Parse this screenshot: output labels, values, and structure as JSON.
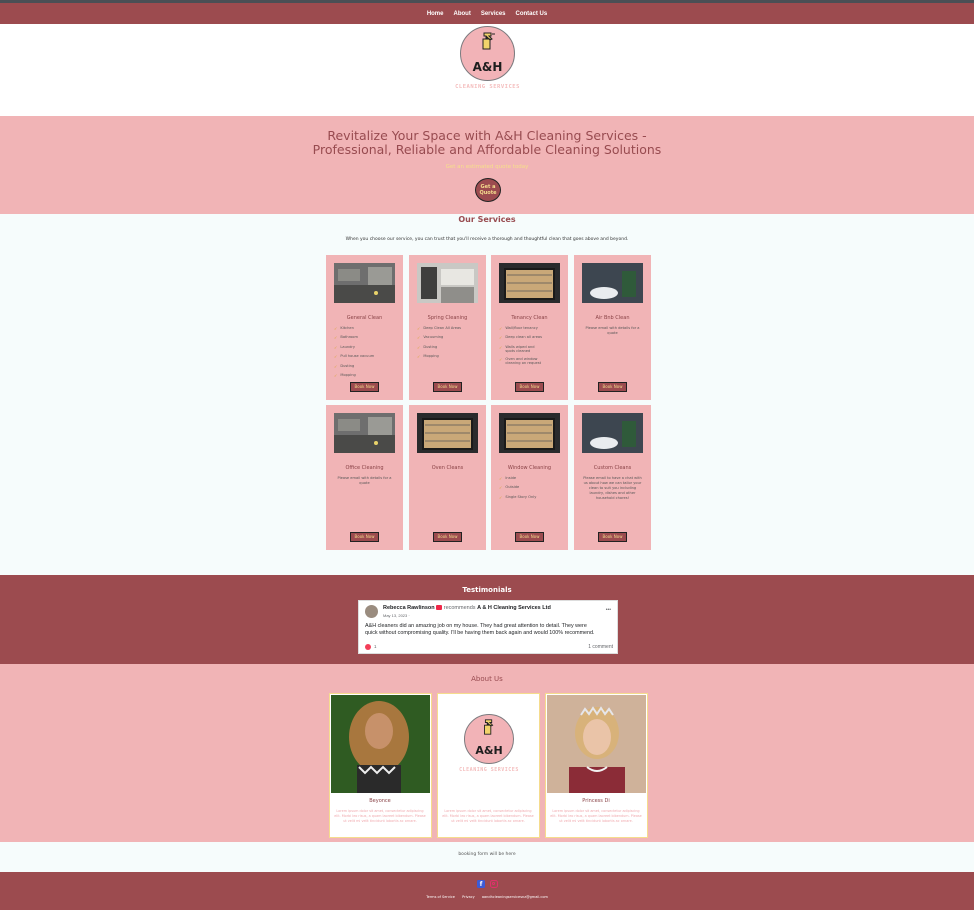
{
  "nav": {
    "items": [
      "Home",
      "About",
      "Services",
      "Contact Us"
    ]
  },
  "logo": {
    "initials": "A&H",
    "subtitle": "CLEANING SERVICES"
  },
  "hero": {
    "title_line1": "Revitalize Your Space with A&H Cleaning Services -",
    "title_line2": "Professional, Reliable and Affordable Cleaning Solutions",
    "quote_text": "Get an estimated quote today",
    "quote_button_line1": "Get a",
    "quote_button_line2": "Quote"
  },
  "services": {
    "title": "Our Services",
    "intro": "When you choose our service, you can trust that you'll receive a thorough and thoughtful clean that goes above and beyond.",
    "book_label": "Book Now",
    "cards": [
      {
        "title": "General Clean",
        "items": [
          "Kitchen",
          "Bathroom",
          "Laundry",
          "Pull house vacuum",
          "Dusting",
          "Mopping"
        ]
      },
      {
        "title": "Spring Cleaning",
        "items": [
          "Deep Clean All Areas",
          "Vacuuming",
          "Dusting",
          "Mopping"
        ]
      },
      {
        "title": "Tenancy Clean",
        "items": [
          "Wall/floor tenancy",
          "Deep clean all areas",
          "Walls wiped and spots cleaned",
          "Oven and window cleaning on request"
        ]
      },
      {
        "title": "Air Bnb Clean",
        "desc": "Please email with details for a quote"
      },
      {
        "title": "Office Cleaning",
        "desc": "Please email with details for a quote"
      },
      {
        "title": "Oven Cleans",
        "desc": ""
      },
      {
        "title": "Window Cleaning",
        "items": [
          "Inside",
          "Outside",
          "Single Story Only"
        ]
      },
      {
        "title": "Custom Cleans",
        "desc": "Please email to have a chat with us about how we can tailor your clean to suit you including laundry, dishes and other household chores!"
      }
    ]
  },
  "testimonials": {
    "title": "Testimonials",
    "post": {
      "author": "Rebecca Rawlinson",
      "recommends": "recommends",
      "business": "A & H Cleaning Services Ltd",
      "date": "May 13, 2023 ·",
      "text_line1": "A&H cleaners did an amazing job on my house. They had great attention to detail. They were",
      "text_line2": "quick without compromising quality. I'll be having them back again and would 100% recommend.",
      "reactions": "1",
      "comments": "1 comment",
      "more": "•••"
    }
  },
  "about": {
    "title": "About Us",
    "people": [
      {
        "name": "Beyonce",
        "desc": "Lorem ipsum dolor sit amet, consectetur adipiscing elit. Morbi leo risus, a quam laoreet bibendum. Please ut velit mi velit tincidunt lobortis ac ornare."
      },
      {
        "name": "",
        "desc": "Lorem ipsum dolor sit amet, consectetur adipiscing elit. Morbi leo risus, a quam laoreet bibendum. Please ut velit mi velit tincidunt lobortis ac ornare."
      },
      {
        "name": "Princess Di",
        "desc": "Lorem ipsum dolor sit amet, consectetur adipiscing elit. Morbi leo risus, a quam laoreet bibendum. Please ut velit mi velit tincidunt lobortis ac ornare."
      }
    ]
  },
  "booking": {
    "text": "booking form will be here"
  },
  "footer": {
    "links": [
      "Terms of Service",
      "Privacy",
      "aandhcleaningservicesnz@gmail.com"
    ],
    "icons": [
      "facebook-icon",
      "instagram-icon"
    ]
  },
  "colors": {
    "brand": "#9c4b4f",
    "pink": "#f1b4b6",
    "accent": "#f5dc8d",
    "bg": "#f6fcfc"
  }
}
